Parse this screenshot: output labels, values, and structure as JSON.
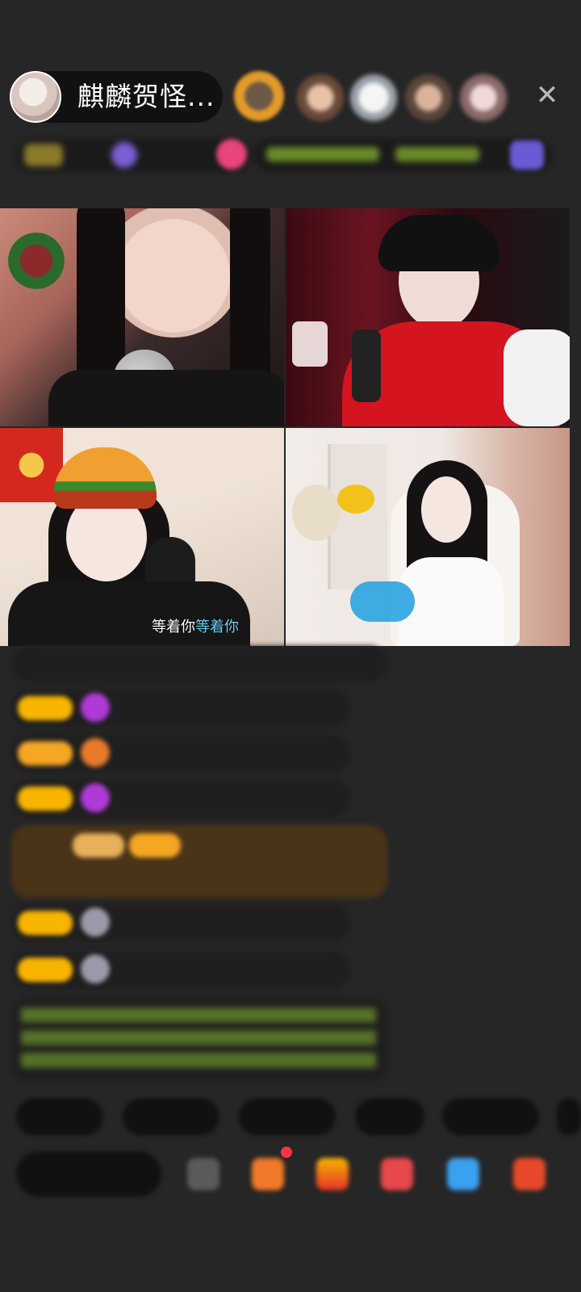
{
  "host": {
    "name": "麒麟贺怪..."
  },
  "top_bar": {
    "viewers": [
      "viewer-1",
      "viewer-2",
      "viewer-3",
      "viewer-4",
      "viewer-5"
    ],
    "close_icon": "close-icon"
  },
  "video": {
    "lyric_part1": "等着你",
    "lyric_part2": "等着你"
  },
  "colors": {
    "background": "#262626",
    "badge_gold": "#f7b500",
    "badge_orange": "#f5a623",
    "lyric_highlight": "#6ad0f3",
    "chat_system_green": "#7bbf3f"
  }
}
